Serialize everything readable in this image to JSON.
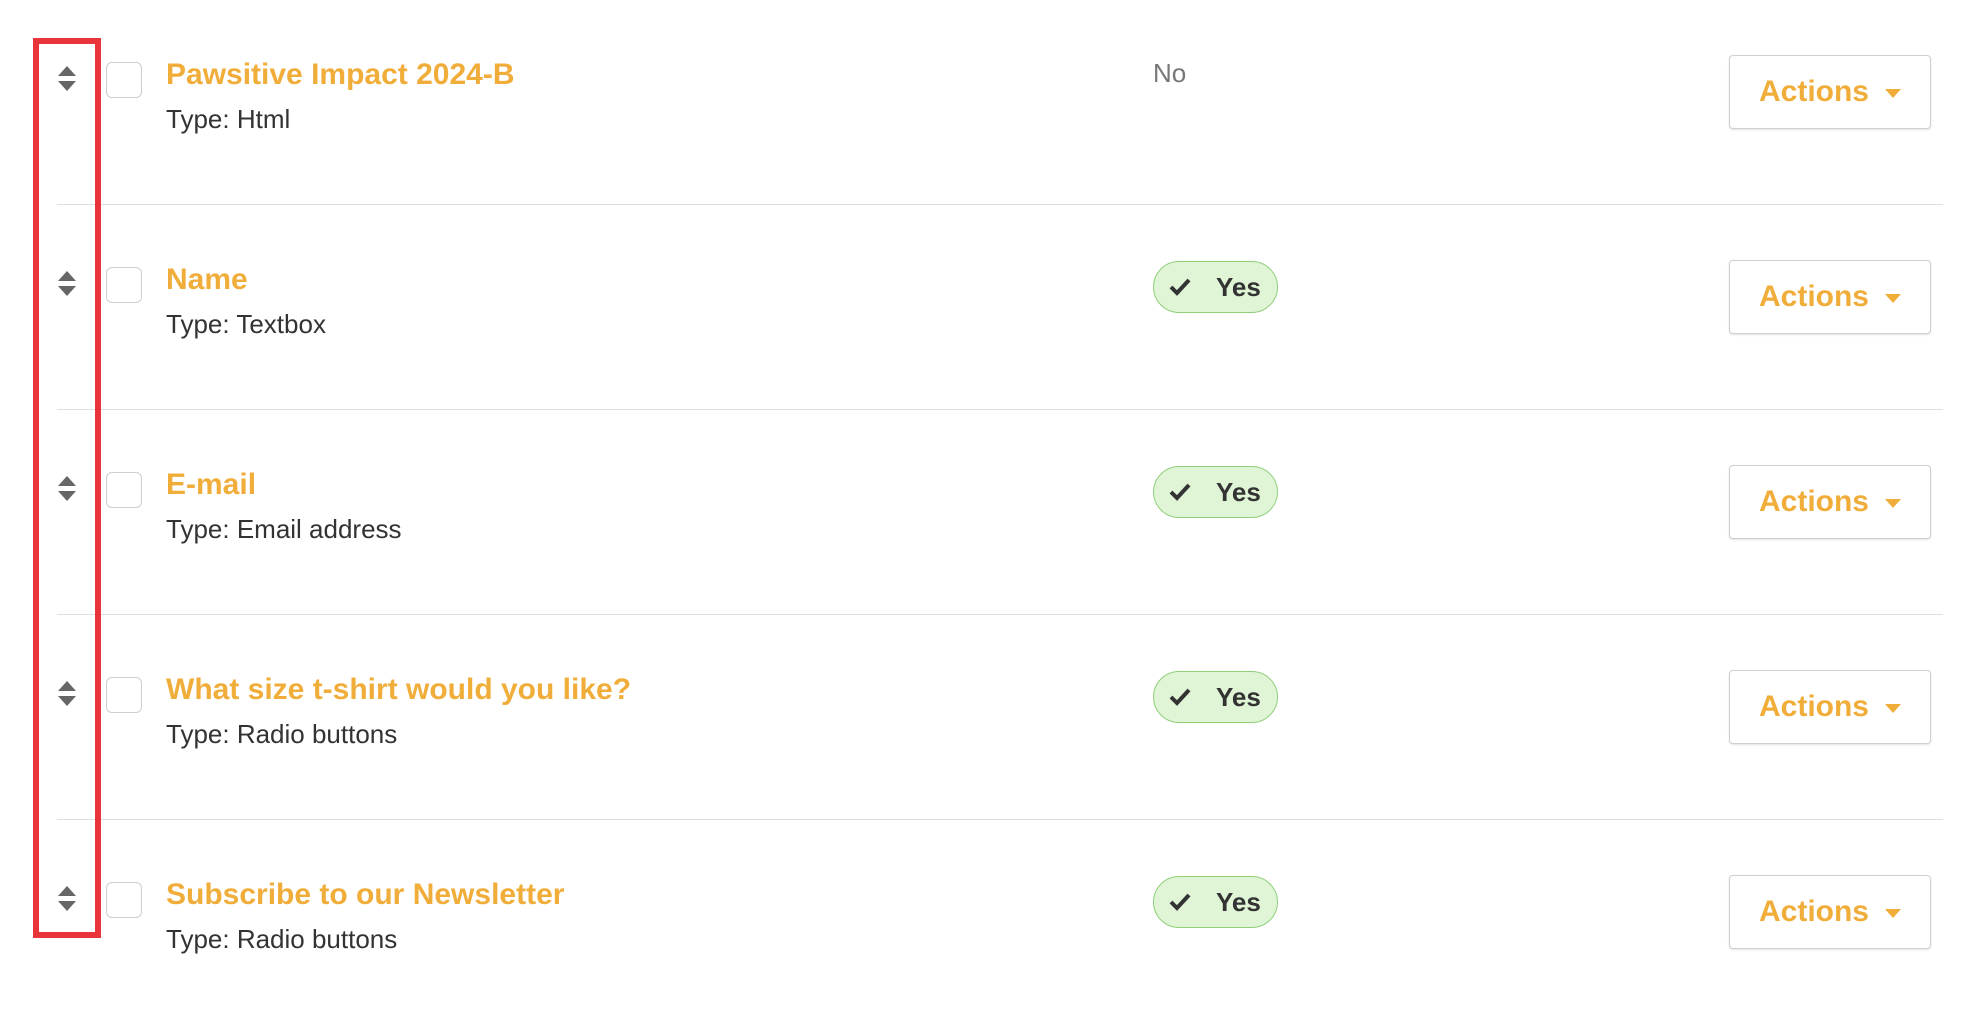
{
  "colors": {
    "accent": "#f0ad3a",
    "badge_bg": "#dff5d5",
    "badge_border": "#8fcf7a",
    "highlight": "#e8343a"
  },
  "fields": [
    {
      "title": "Pawsitive Impact 2024-B",
      "type": "Type: Html",
      "required": false,
      "required_label": "No",
      "actions_label": "Actions"
    },
    {
      "title": "Name",
      "type": "Type: Textbox",
      "required": true,
      "required_label": "Yes",
      "actions_label": "Actions"
    },
    {
      "title": "E-mail",
      "type": "Type: Email address",
      "required": true,
      "required_label": "Yes",
      "actions_label": "Actions"
    },
    {
      "title": "What size t-shirt would you like?",
      "type": "Type: Radio buttons",
      "required": true,
      "required_label": "Yes",
      "actions_label": "Actions"
    },
    {
      "title": "Subscribe to our Newsletter",
      "type": "Type: Radio buttons",
      "required": true,
      "required_label": "Yes",
      "actions_label": "Actions"
    }
  ]
}
